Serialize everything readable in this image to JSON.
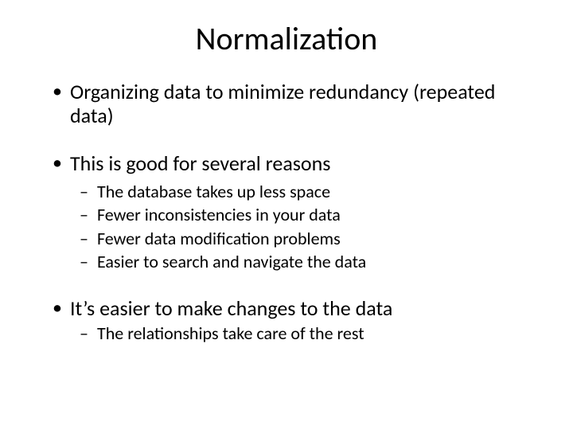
{
  "title": "Normalization",
  "bullets": {
    "b1": "Organizing data to minimize redundancy (repeated data)",
    "b2": "This is good for several reasons",
    "b2_subs": {
      "s1": "The database takes up less space",
      "s2": "Fewer inconsistencies in your data",
      "s3": "Fewer data modification problems",
      "s4": "Easier to search and navigate the data"
    },
    "b3": "It’s easier to make changes to the data",
    "b3_subs": {
      "s1": "The relationships take care of the rest"
    }
  }
}
